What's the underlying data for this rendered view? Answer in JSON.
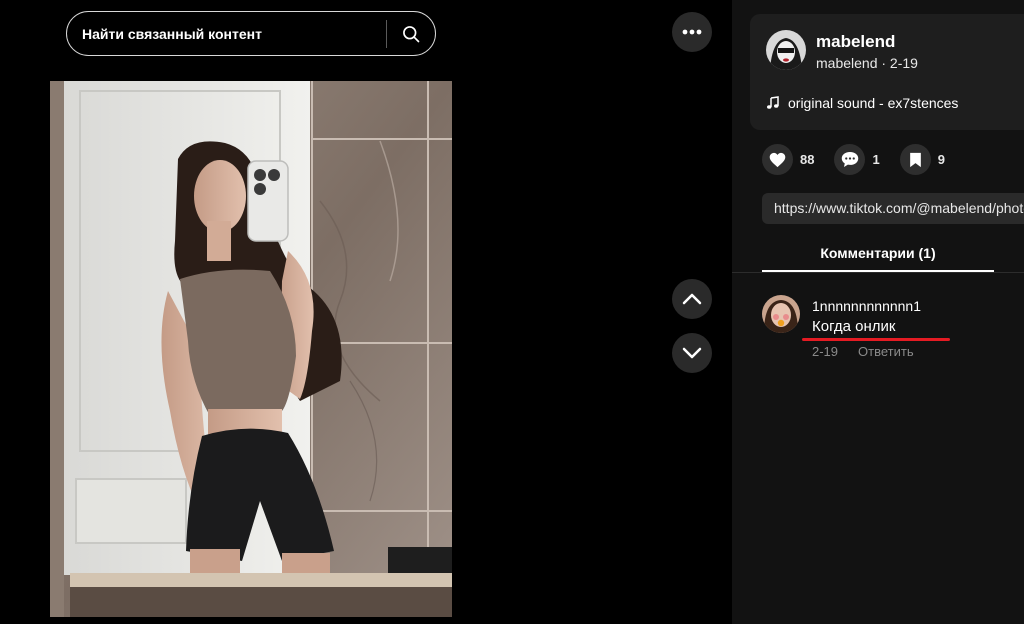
{
  "search": {
    "placeholder": "Найти связанный контент",
    "icon": "search-icon"
  },
  "more_icon": "more-horizontal-icon",
  "nav": {
    "up_icon": "chevron-up-icon",
    "down_icon": "chevron-down-icon"
  },
  "author": {
    "name": "mabelend",
    "meta": "mabelend · 2-19",
    "sound": "original sound - ex7stences",
    "sound_icon": "music-note-icon"
  },
  "actions": {
    "likes": "88",
    "comments": "1",
    "saves": "9"
  },
  "link": "https://www.tiktok.com/@mabelend/photo",
  "tabs": {
    "comments_label": "Комментарии (1)"
  },
  "comments": [
    {
      "author": "1nnnnnnnnnnnn1",
      "text": "Когда онлик",
      "date": "2-19",
      "reply_label": "Ответить"
    }
  ],
  "colors": {
    "background": "#000000",
    "panel": "#121212",
    "card": "#1e1e1e",
    "button": "#2a2a2a",
    "highlight": "#e51b23"
  }
}
